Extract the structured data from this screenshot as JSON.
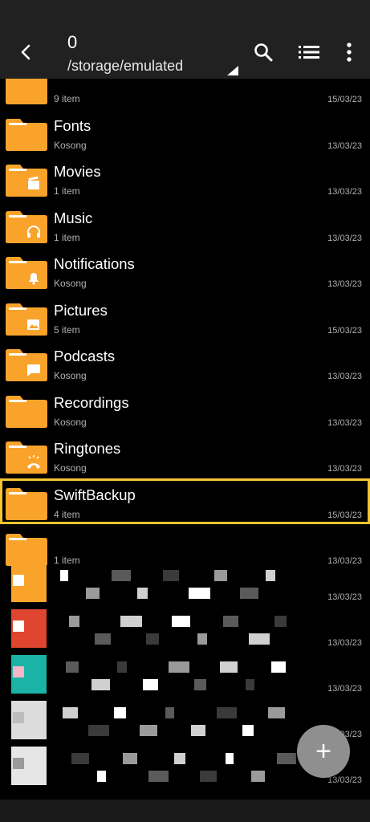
{
  "header": {
    "title": "0",
    "path": "/storage/emulated"
  },
  "rows": [
    {
      "name": "",
      "meta": "9 item",
      "date": "15/03/23",
      "glyph": "none"
    },
    {
      "name": "Fonts",
      "meta": "Kosong",
      "date": "13/03/23",
      "glyph": "none"
    },
    {
      "name": "Movies",
      "meta": "1 item",
      "date": "13/03/23",
      "glyph": "film-icon"
    },
    {
      "name": "Music",
      "meta": "1 item",
      "date": "13/03/23",
      "glyph": "headphones-icon"
    },
    {
      "name": "Notifications",
      "meta": "Kosong",
      "date": "13/03/23",
      "glyph": "bell-icon"
    },
    {
      "name": "Pictures",
      "meta": "5 item",
      "date": "15/03/23",
      "glyph": "image-icon"
    },
    {
      "name": "Podcasts",
      "meta": "Kosong",
      "date": "13/03/23",
      "glyph": "chat-icon"
    },
    {
      "name": "Recordings",
      "meta": "Kosong",
      "date": "13/03/23",
      "glyph": "none"
    },
    {
      "name": "Ringtones",
      "meta": "Kosong",
      "date": "13/03/23",
      "glyph": "phone-ring-icon"
    },
    {
      "name": "SwiftBackup",
      "meta": "4 item",
      "date": "15/03/23",
      "glyph": "none",
      "selected": true
    },
    {
      "name": "",
      "meta": "1 item",
      "date": "13/03/23",
      "glyph": "none"
    }
  ],
  "obscured_dates": [
    "13/03/23",
    "13/03/23",
    "13/03/23",
    "13/03/23",
    "13/03/23"
  ],
  "fab": {
    "label": "+"
  },
  "colors": {
    "folder": "#f9a32b",
    "folder_tab": "#fbb746",
    "selection": "#f4c430",
    "appbar": "#212121",
    "fab": "#8f8f8f"
  }
}
